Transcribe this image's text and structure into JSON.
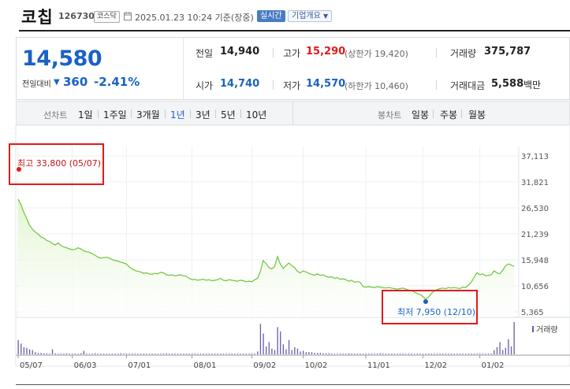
{
  "header": {
    "stock_name": "코칩",
    "stock_code": "126730",
    "market": "코스닥",
    "timestamp": "2025.01.23 10:24 기준(장중)",
    "realtime_label": "실시간",
    "company_info_label": "기업개요",
    "company_info_icon": "chevron-down-icon"
  },
  "price": {
    "current": "14,580",
    "change_label": "전일대비",
    "change_direction": "down",
    "change_value": "360",
    "change_pct": "-2.41%"
  },
  "stats": {
    "prev_close_label": "전일",
    "prev_close": "14,940",
    "high_label": "고가",
    "high": "15,290",
    "upper_limit": "(상한가 19,420)",
    "volume_label": "거래량",
    "volume": "375,787",
    "open_label": "시가",
    "open": "14,740",
    "low_label": "저가",
    "low": "14,570",
    "lower_limit": "(하한가 10,460)",
    "value_label": "거래대금",
    "value": "5,588",
    "value_unit": "백만"
  },
  "period": {
    "line_chart_label": "선차트",
    "line_tabs": [
      "1일",
      "1주일",
      "3개월",
      "1년",
      "3년",
      "5년",
      "10년"
    ],
    "active_tab": "1년",
    "candle_chart_label": "봉차트",
    "candle_tabs": [
      "일봉",
      "주봉",
      "월봉"
    ]
  },
  "colors": {
    "down": "#1a62c6",
    "up": "#e4191b",
    "line": "#6dc43a",
    "fill": "#dff5cc",
    "volume_bar": "#6a5aa8",
    "highlight_box": "#e4191b"
  },
  "chart_data": {
    "type": "area",
    "y_ticks": [
      "37,113",
      "31,821",
      "26,530",
      "21,239",
      "15,948",
      "10,656",
      "5,365"
    ],
    "ylim": [
      5365,
      37113
    ],
    "x_tick_labels": [
      "05/07",
      "06/03",
      "07/01",
      "08/01",
      "09/02",
      "10/02",
      "11/01",
      "12/02",
      "01/02"
    ],
    "x_tick_index": [
      0,
      19,
      38,
      61,
      82,
      100,
      122,
      142,
      162
    ],
    "high_annotation": "최고 33,800 (05/07)",
    "low_annotation": "최저 7,950 (12/10)",
    "volume_legend": "거래량",
    "price_series": [
      28300,
      27200,
      25600,
      24400,
      23000,
      22200,
      21600,
      21200,
      20600,
      20400,
      19900,
      19700,
      19300,
      19000,
      19400,
      18900,
      18600,
      18400,
      18200,
      18000,
      18100,
      18400,
      18200,
      17800,
      17600,
      17500,
      17200,
      16900,
      16500,
      16300,
      16400,
      16500,
      16300,
      16000,
      15800,
      15700,
      15500,
      15300,
      15100,
      14500,
      14100,
      13800,
      13600,
      13500,
      13200,
      13300,
      13100,
      13000,
      13200,
      13100,
      13400,
      13300,
      12900,
      12800,
      12900,
      12700,
      12800,
      12900,
      12700,
      12600,
      12200,
      11900,
      12000,
      11800,
      11900,
      12000,
      11800,
      11900,
      11700,
      11800,
      11900,
      12200,
      11800,
      11700,
      11900,
      11800,
      11700,
      11600,
      11800,
      11700,
      11500,
      11600,
      11500,
      11900,
      12200,
      13600,
      15800,
      15200,
      14400,
      14100,
      14600,
      16600,
      15100,
      14200,
      14800,
      15300,
      14800,
      14400,
      13600,
      13300,
      13700,
      13500,
      13200,
      13000,
      12800,
      13100,
      12800,
      12900,
      12600,
      12400,
      12500,
      12200,
      12300,
      12000,
      12100,
      11900,
      11600,
      11800,
      11400,
      11500,
      11400,
      10500,
      10400,
      10500,
      10400,
      10300,
      10500,
      10400,
      10300,
      10200,
      10300,
      10200,
      10100,
      10000,
      10100,
      10200,
      10000,
      9800,
      9700,
      9400,
      9100,
      8900,
      8500,
      7950,
      8400,
      9100,
      9600,
      9900,
      10100,
      10200,
      10100,
      10300,
      10200,
      10300,
      10200,
      10100,
      10400,
      10300,
      10800,
      11400,
      12400,
      13300,
      12900,
      13100,
      12700,
      12800,
      12900,
      13700,
      13300,
      13100,
      13800,
      14700,
      15100,
      14900,
      14580
    ],
    "volume_series": [
      40,
      30,
      20,
      18,
      14,
      12,
      6,
      4,
      4,
      3,
      3,
      2,
      14,
      3,
      2,
      2,
      2,
      3,
      2,
      2,
      2,
      2,
      3,
      10,
      2,
      2,
      2,
      3,
      2,
      2,
      2,
      2,
      2,
      2,
      2,
      2,
      3,
      2,
      2,
      2,
      2,
      2,
      2,
      2,
      2,
      2,
      2,
      2,
      2,
      2,
      2,
      2,
      3,
      2,
      2,
      2,
      2,
      2,
      2,
      2,
      2,
      2,
      2,
      2,
      2,
      2,
      2,
      2,
      2,
      2,
      2,
      2,
      2,
      2,
      2,
      2,
      2,
      2,
      2,
      2,
      2,
      2,
      2,
      2,
      8,
      85,
      58,
      22,
      34,
      16,
      12,
      76,
      64,
      28,
      14,
      40,
      12,
      20,
      16,
      8,
      10,
      6,
      6,
      6,
      4,
      4,
      4,
      3,
      3,
      3,
      2,
      2,
      2,
      2,
      2,
      2,
      3,
      2,
      2,
      2,
      2,
      2,
      2,
      2,
      2,
      2,
      2,
      3,
      2,
      2,
      2,
      2,
      2,
      2,
      2,
      2,
      2,
      2,
      2,
      2,
      2,
      2,
      2,
      2,
      2,
      2,
      2,
      2,
      2,
      2,
      2,
      2,
      2,
      2,
      2,
      2,
      2,
      2,
      2,
      2,
      2,
      2,
      2,
      2,
      2,
      2,
      2,
      12,
      20,
      34,
      12,
      18,
      42,
      22,
      90
    ]
  }
}
